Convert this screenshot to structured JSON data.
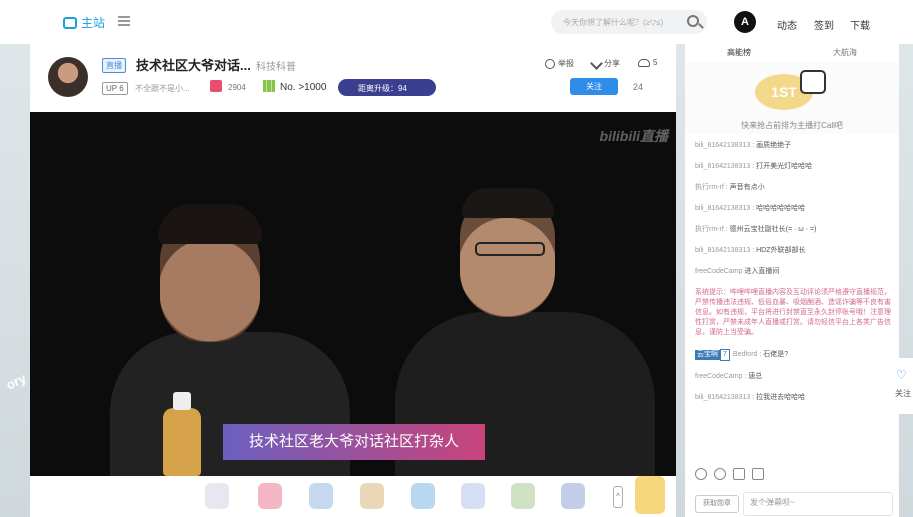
{
  "nav": {
    "brand_label": "主站",
    "search_placeholder": "今天你想了解什么呢？(≥▽≤)",
    "avatar_letter": "A",
    "links": [
      "动态",
      "签到",
      "下载"
    ]
  },
  "background": {
    "text": "ory"
  },
  "room": {
    "live_badge": "直播",
    "title": "技术社区大爷对话...",
    "category": "科技科普",
    "up_badge": "UP 6",
    "up_name": "不全跟不是小...",
    "gift_count": "2904",
    "rank": "No. >1000",
    "level_text": "距离升级：94",
    "report_label": "举报",
    "share_label": "分享",
    "viewer_count": "5",
    "follow_label": "关注",
    "follow_count": "24"
  },
  "video": {
    "watermark": "bilibili直播",
    "caption": "技术社区老大爷对话社区打杂人"
  },
  "gift_bar": {
    "more_label": "^"
  },
  "side": {
    "tabs": [
      "高能榜",
      "大航海"
    ],
    "rank_badge": "1ST",
    "rank_tip": "快来抢占前排为主播打Call吧",
    "chat": [
      {
        "user": "bili_81642138313",
        "msg": "画质绝绝子"
      },
      {
        "user": "bili_81642138313",
        "msg": "打开美光灯哈哈哈"
      },
      {
        "user": "执行rm-rf",
        "msg": "声音有点小"
      },
      {
        "user": "bili_81642138313",
        "msg": "哈哈哈哈哈哈哈"
      },
      {
        "user": "执行rm-rf",
        "msg": "德州云宝社副社长(= · ω · =)"
      },
      {
        "user": "bili_81642138313",
        "msg": "HDZ外联部部长"
      },
      {
        "user": "freeCodeCamp",
        "msg": "进入直播间"
      }
    ],
    "system_notice": "系统提示：哔哩哔哩直播内容及互动评论须严格遵守直播规范，严禁传播违法违规、低俗血暴、吸烟酗酒、造谣诈骗等不良有害信息。如有违规，平台将进行封禁直至永久封停账号哦！注意理性打赏，严禁未成年人直播或打赏。请勿轻信平台上各类广告信息，谨防上当受骗。",
    "medal": "云宝啊",
    "medal_level": "7",
    "chat_after": [
      {
        "user": "Bedford",
        "msg": "石佬是?"
      },
      {
        "user": "freeCodeCamp",
        "msg": "唐总"
      },
      {
        "user": "bili_81642138313",
        "msg": "拉我进去哈哈哈"
      }
    ],
    "medal_btn": "获取勋章",
    "input_placeholder": "发个弹幕呗~"
  },
  "float": {
    "follow_label": "关注"
  }
}
